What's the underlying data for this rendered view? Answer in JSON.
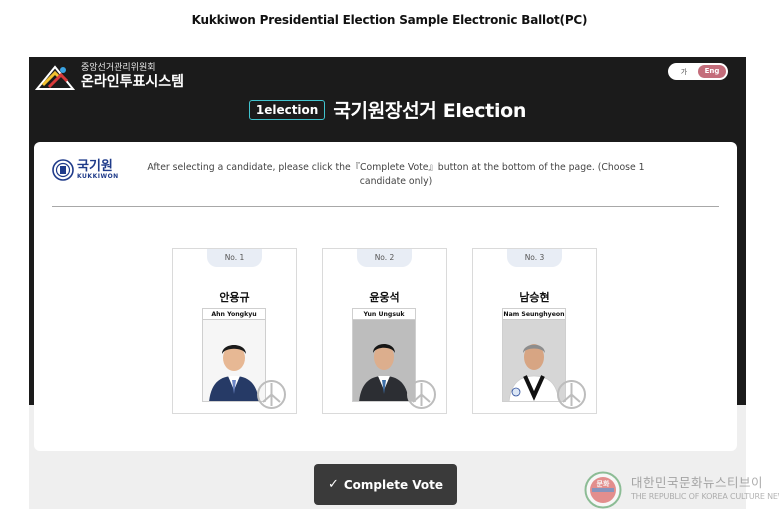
{
  "page_caption": "Kukkiwon Presidential Election Sample Electronic Ballot(PC)",
  "header": {
    "org_top": "중앙선거관리위원회",
    "org_main": "온라인투표시스템",
    "lang_toggle": {
      "korean": "가",
      "english": "Eng",
      "selected": "Eng",
      "accent": "#c46d7b"
    }
  },
  "election": {
    "badge": "1election",
    "title": "국기원장선거 Election",
    "badge_color": "#41c4cf"
  },
  "panel": {
    "logo_ko": "국기원",
    "logo_en": "KUKKIWON",
    "instruction": "After selecting a candidate, please click the『Complete Vote』button at the bottom of the page. (Choose 1 candidate only)"
  },
  "candidates": [
    {
      "number": "No. 1",
      "name_ko": "안용규",
      "name_en": "Ahn Yongkyu"
    },
    {
      "number": "No. 2",
      "name_ko": "윤웅석",
      "name_en": "Yun Ungsuk"
    },
    {
      "number": "No. 3",
      "name_ko": "남승현",
      "name_en": "Nam Seunghyeon"
    }
  ],
  "actions": {
    "complete_vote": "Complete Vote",
    "complete_vote_icon": "check-icon"
  },
  "watermark": {
    "seal_text": "문화",
    "korean": "대한민국문화뉴스티브이",
    "english": "THE REPUBLIC OF KOREA CULTURE NEWS TV"
  }
}
